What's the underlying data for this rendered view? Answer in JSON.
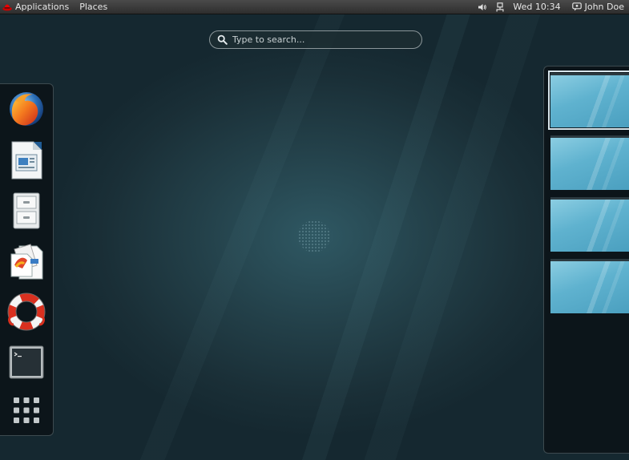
{
  "topbar": {
    "applications_label": "Applications",
    "places_label": "Places",
    "clock": "Wed 10:34",
    "user_name": "John Doe",
    "bg_color": "#3a3a3a"
  },
  "search": {
    "placeholder": "Type to search...",
    "value": ""
  },
  "dash": {
    "items": [
      {
        "name": "firefox",
        "icon": "firefox-icon"
      },
      {
        "name": "libreoffice-impress",
        "icon": "document-icon"
      },
      {
        "name": "files",
        "icon": "file-cabinet-icon"
      },
      {
        "name": "documents",
        "icon": "documents-icon"
      },
      {
        "name": "help",
        "icon": "lifebuoy-icon"
      },
      {
        "name": "terminal",
        "icon": "terminal-icon"
      },
      {
        "name": "show-applications",
        "icon": "grid-icon"
      }
    ]
  },
  "workspaces": {
    "count": 4,
    "active_index": 0,
    "accent": "#5fb2cf"
  }
}
